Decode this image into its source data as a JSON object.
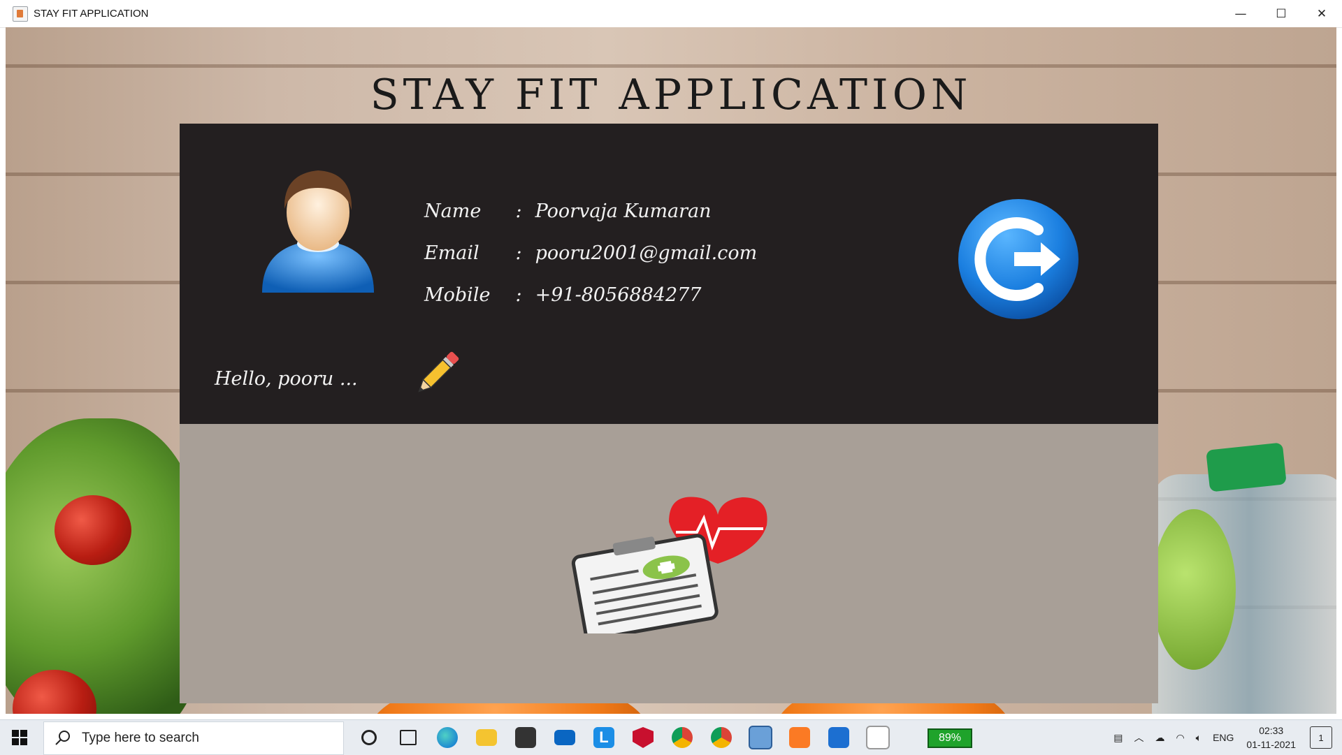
{
  "window": {
    "title": "STAY FIT APPLICATION",
    "controls": {
      "minimize": "—",
      "maximize": "☐",
      "close": "✕"
    }
  },
  "app": {
    "heading": "STAY FIT APPLICATION",
    "greeting": "Hello, pooru ...",
    "profile": {
      "name_label": "Name",
      "name_value": "Poorvaja Kumaran",
      "email_label": "Email",
      "email_value": "pooru2001@gmail.com",
      "mobile_label": "Mobile",
      "mobile_value": "+91-8056884277",
      "separator": ":"
    },
    "colors": {
      "profile_panel": "#231f20",
      "health_panel": "#a89f97",
      "logout_button": "#1b7fe0"
    }
  },
  "taskbar": {
    "search_placeholder": "Type here to search",
    "battery": "89%",
    "language": "ENG",
    "time": "02:33",
    "date": "01-11-2021",
    "notification_count": "1",
    "pinned_icons": [
      "cortana-icon",
      "task-view-icon",
      "edge-icon",
      "file-explorer-icon",
      "store-icon",
      "mail-icon",
      "l-app-icon",
      "mcafee-icon",
      "chrome-icon",
      "chrome-profile-icon",
      "virtualbox-icon",
      "xampp-icon",
      "photos-icon",
      "java-icon"
    ]
  }
}
